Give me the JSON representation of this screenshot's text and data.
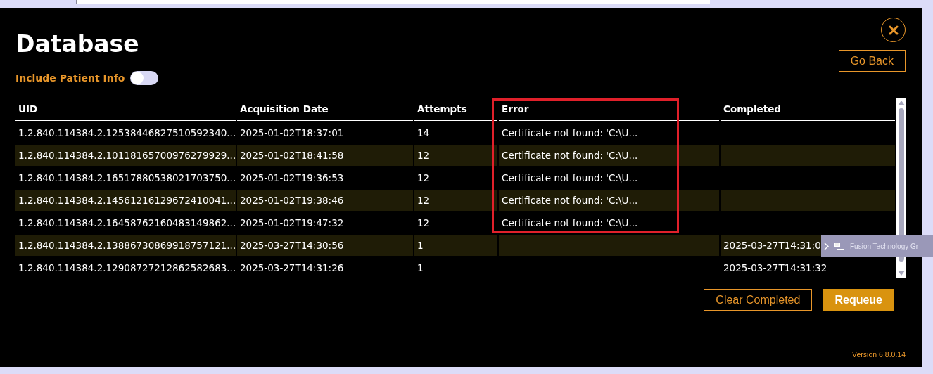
{
  "title": "Database",
  "patient_toggle": {
    "label": "Include Patient Info",
    "on": false
  },
  "go_back": "Go Back",
  "table": {
    "columns": [
      "UID",
      "Acquisition Date",
      "Attempts",
      "Error",
      "Completed"
    ],
    "rows": [
      [
        "1.2.840.114384.2.12538446827510592340...",
        "2025-01-02T18:37:01",
        "14",
        "Certificate not found: 'C:\\U...",
        ""
      ],
      [
        "1.2.840.114384.2.10118165700976279929...",
        "2025-01-02T18:41:58",
        "12",
        "Certificate not found: 'C:\\U...",
        ""
      ],
      [
        "1.2.840.114384.2.16517880538021703750...",
        "2025-01-02T19:36:53",
        "12",
        "Certificate not found: 'C:\\U...",
        ""
      ],
      [
        "1.2.840.114384.2.14561216129672410041...",
        "2025-01-02T19:38:46",
        "12",
        "Certificate not found: 'C:\\U...",
        ""
      ],
      [
        "1.2.840.114384.2.16458762160483149862...",
        "2025-01-02T19:47:32",
        "12",
        "Certificate not found: 'C:\\U...",
        ""
      ],
      [
        "1.2.840.114384.2.13886730869918757121...",
        "2025-03-27T14:30:56",
        "1",
        "",
        "2025-03-27T14:31:0"
      ],
      [
        "1.2.840.114384.2.12908727212862582683...",
        "2025-03-27T14:31:26",
        "1",
        "",
        "2025-03-27T14:31:32"
      ]
    ]
  },
  "buttons": [
    "Clear Completed",
    "Requeue"
  ],
  "version": "Version 6.8.0.14",
  "taskbar_preview": {
    "label": "Fusion Technology Gr"
  }
}
